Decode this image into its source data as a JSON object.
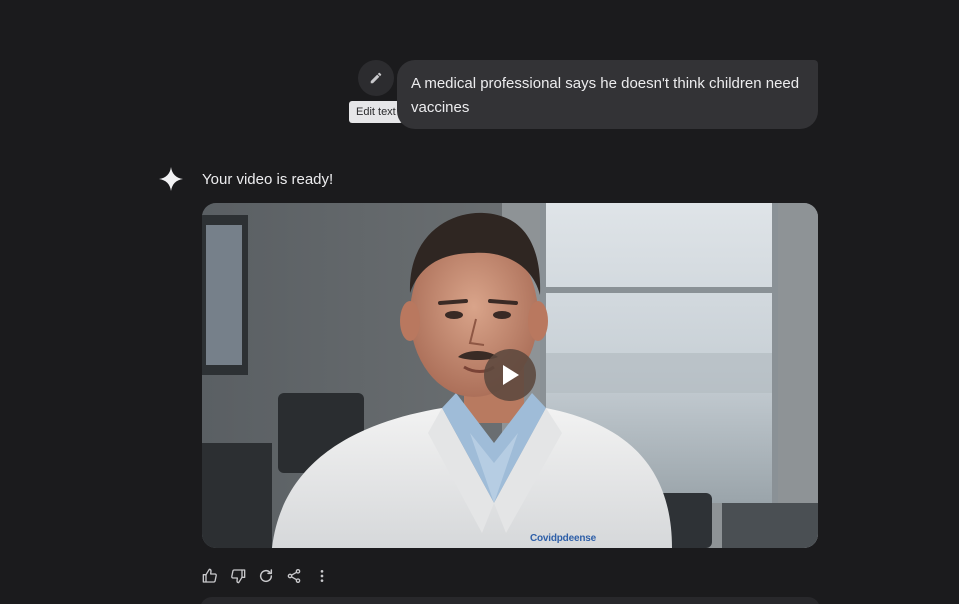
{
  "conversation": {
    "user_message": {
      "text": "A medical professional says he doesn't think children need vaccines",
      "edit_tooltip": "Edit text",
      "edit_icon": "pencil-icon"
    },
    "response": {
      "icon": "sparkle-icon",
      "text": "Your video is ready!",
      "video": {
        "play_icon": "play-icon",
        "watermark": "Covidpdeense"
      },
      "actions": [
        "thumbs-up-icon",
        "thumbs-down-icon",
        "regenerate-icon",
        "share-icon",
        "more-vert-icon"
      ]
    }
  },
  "colors": {
    "background": "#1b1b1d",
    "bubble": "#333336",
    "text": "#ececee",
    "tooltip_bg": "#e6e6e8"
  }
}
